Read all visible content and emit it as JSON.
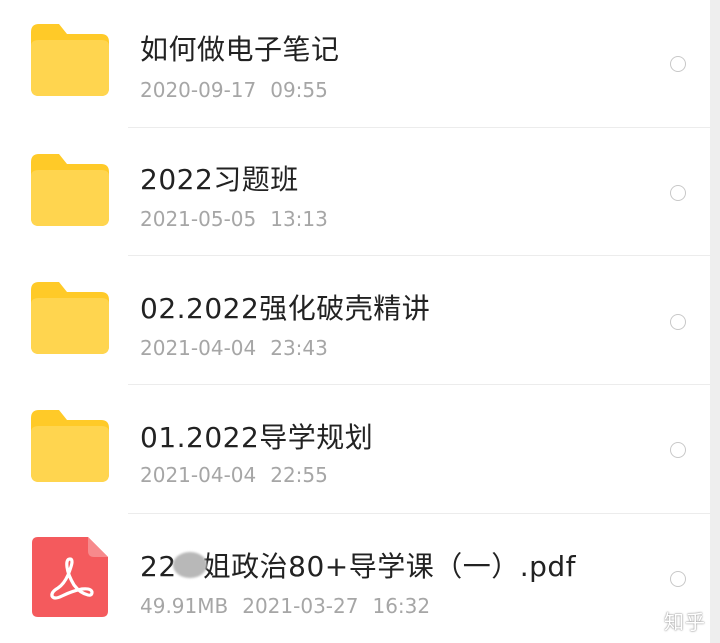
{
  "colors": {
    "folder": "#ffd54f",
    "folder_tab": "#ffca28",
    "pdf": "#f45a5d",
    "name_text": "#222222",
    "meta_text": "#a6a6a6"
  },
  "files": [
    {
      "icon": "folder-icon",
      "name": "如何做电子笔记",
      "date": "2020-09-17",
      "time": "09:55"
    },
    {
      "icon": "folder-icon",
      "name": "2022习题班",
      "date": "2021-05-05",
      "time": "13:13"
    },
    {
      "icon": "folder-icon",
      "name": "02.2022强化破壳精讲",
      "date": "2021-04-04",
      "time": "23:43"
    },
    {
      "icon": "folder-icon",
      "name": "01.2022导学规划",
      "date": "2021-04-04",
      "time": "22:55"
    },
    {
      "icon": "pdf-icon",
      "name_prefix": "22",
      "name_suffix": "姐政治80+导学课（一）.pdf",
      "size": "49.91MB",
      "date": "2021-03-27",
      "time": "16:32"
    }
  ],
  "watermark": "知乎"
}
